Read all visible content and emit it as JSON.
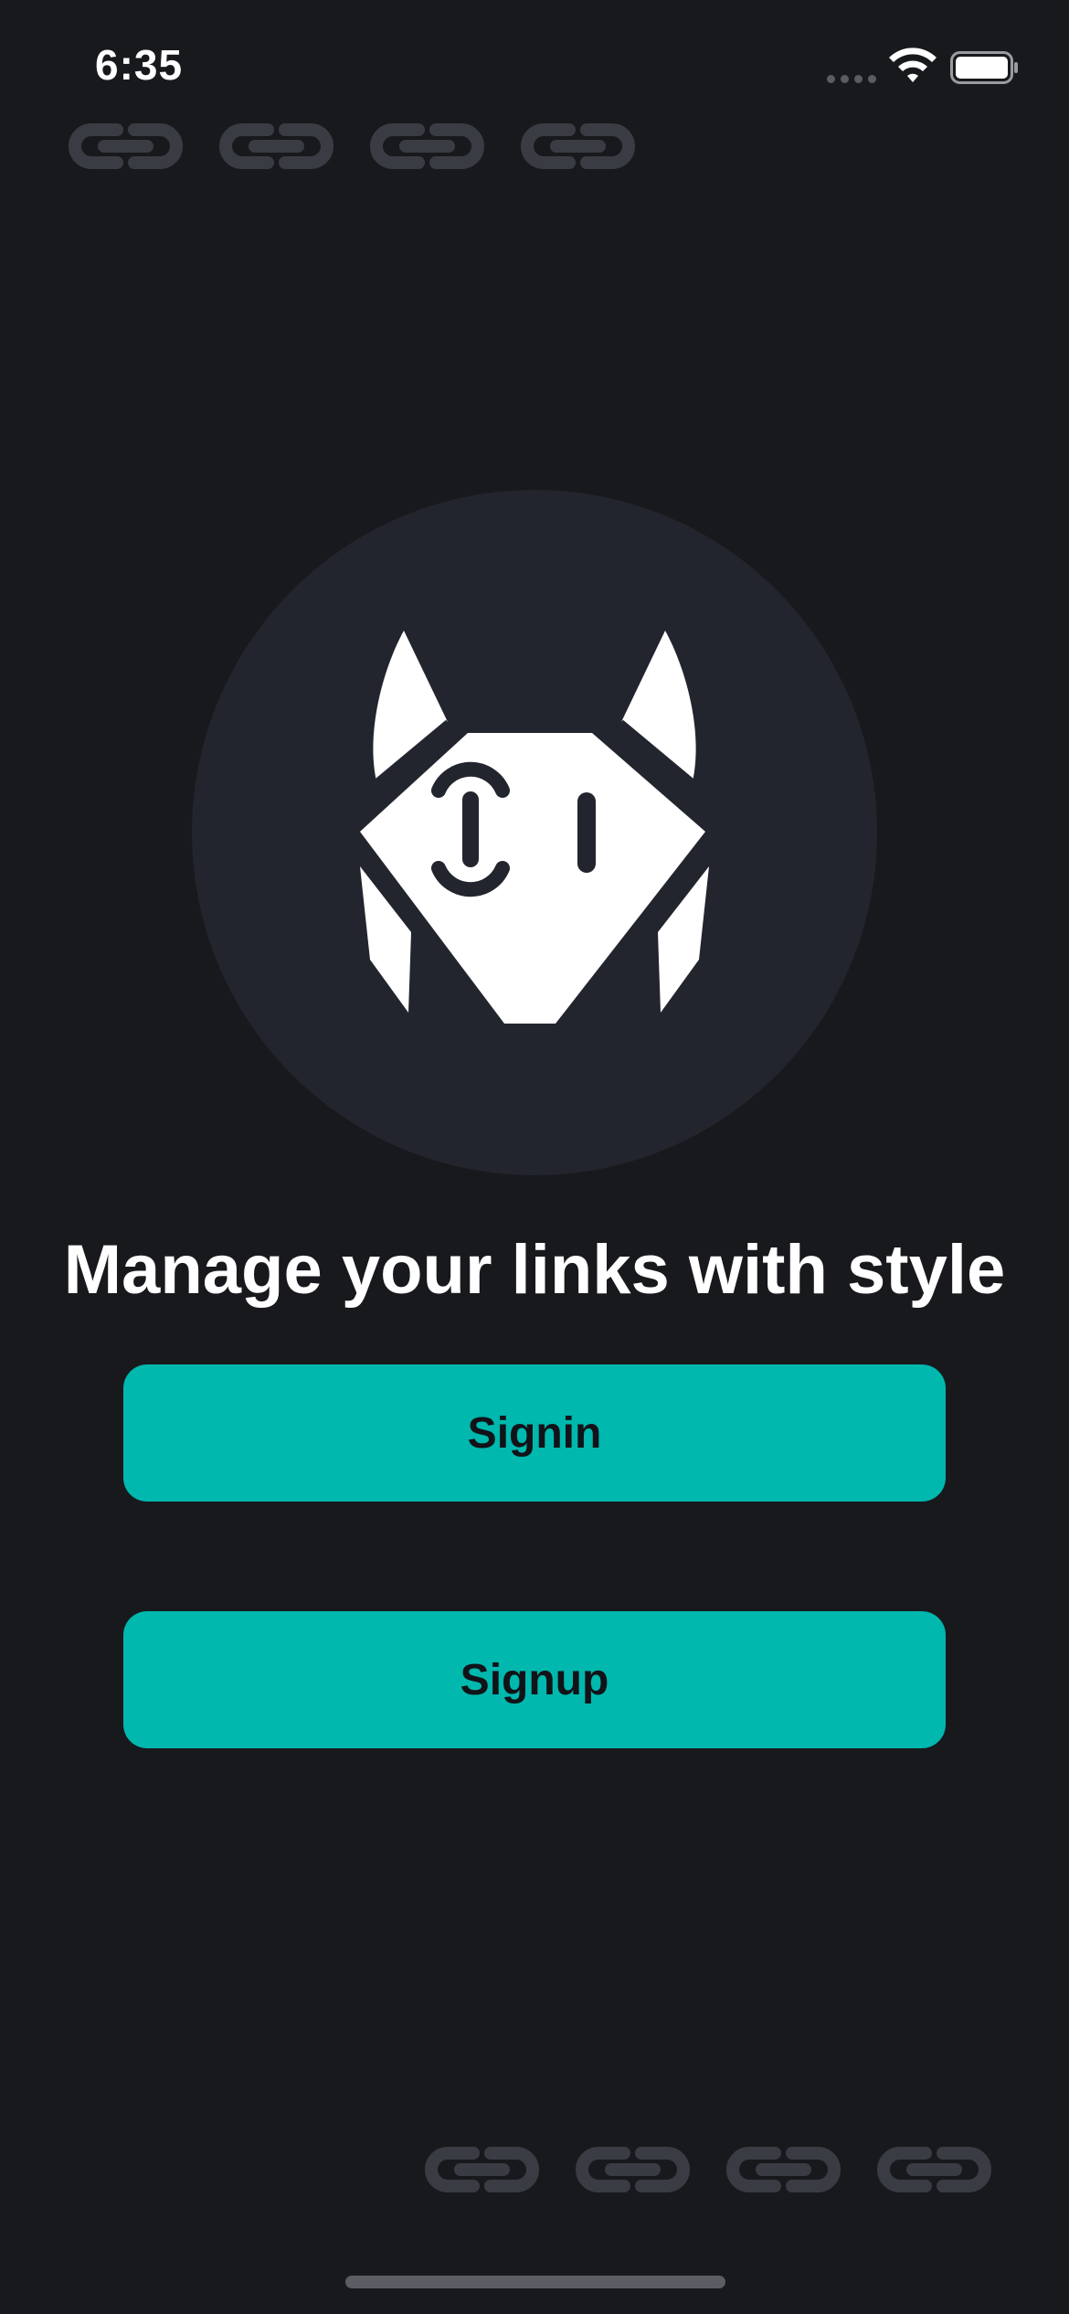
{
  "status_bar": {
    "time": "6:35"
  },
  "hero": {
    "icon": "fox-logo-icon"
  },
  "headline": "Manage your links with style",
  "buttons": {
    "signin_label": "Signin",
    "signup_label": "Signup"
  },
  "decorations": {
    "top_link_icons": 4,
    "bottom_link_icons": 4,
    "icon": "link-chain-icon"
  },
  "colors": {
    "background": "#18191d",
    "accent": "#00b8ad",
    "circle": "#23252e",
    "link_icon": "#3a3c44"
  }
}
